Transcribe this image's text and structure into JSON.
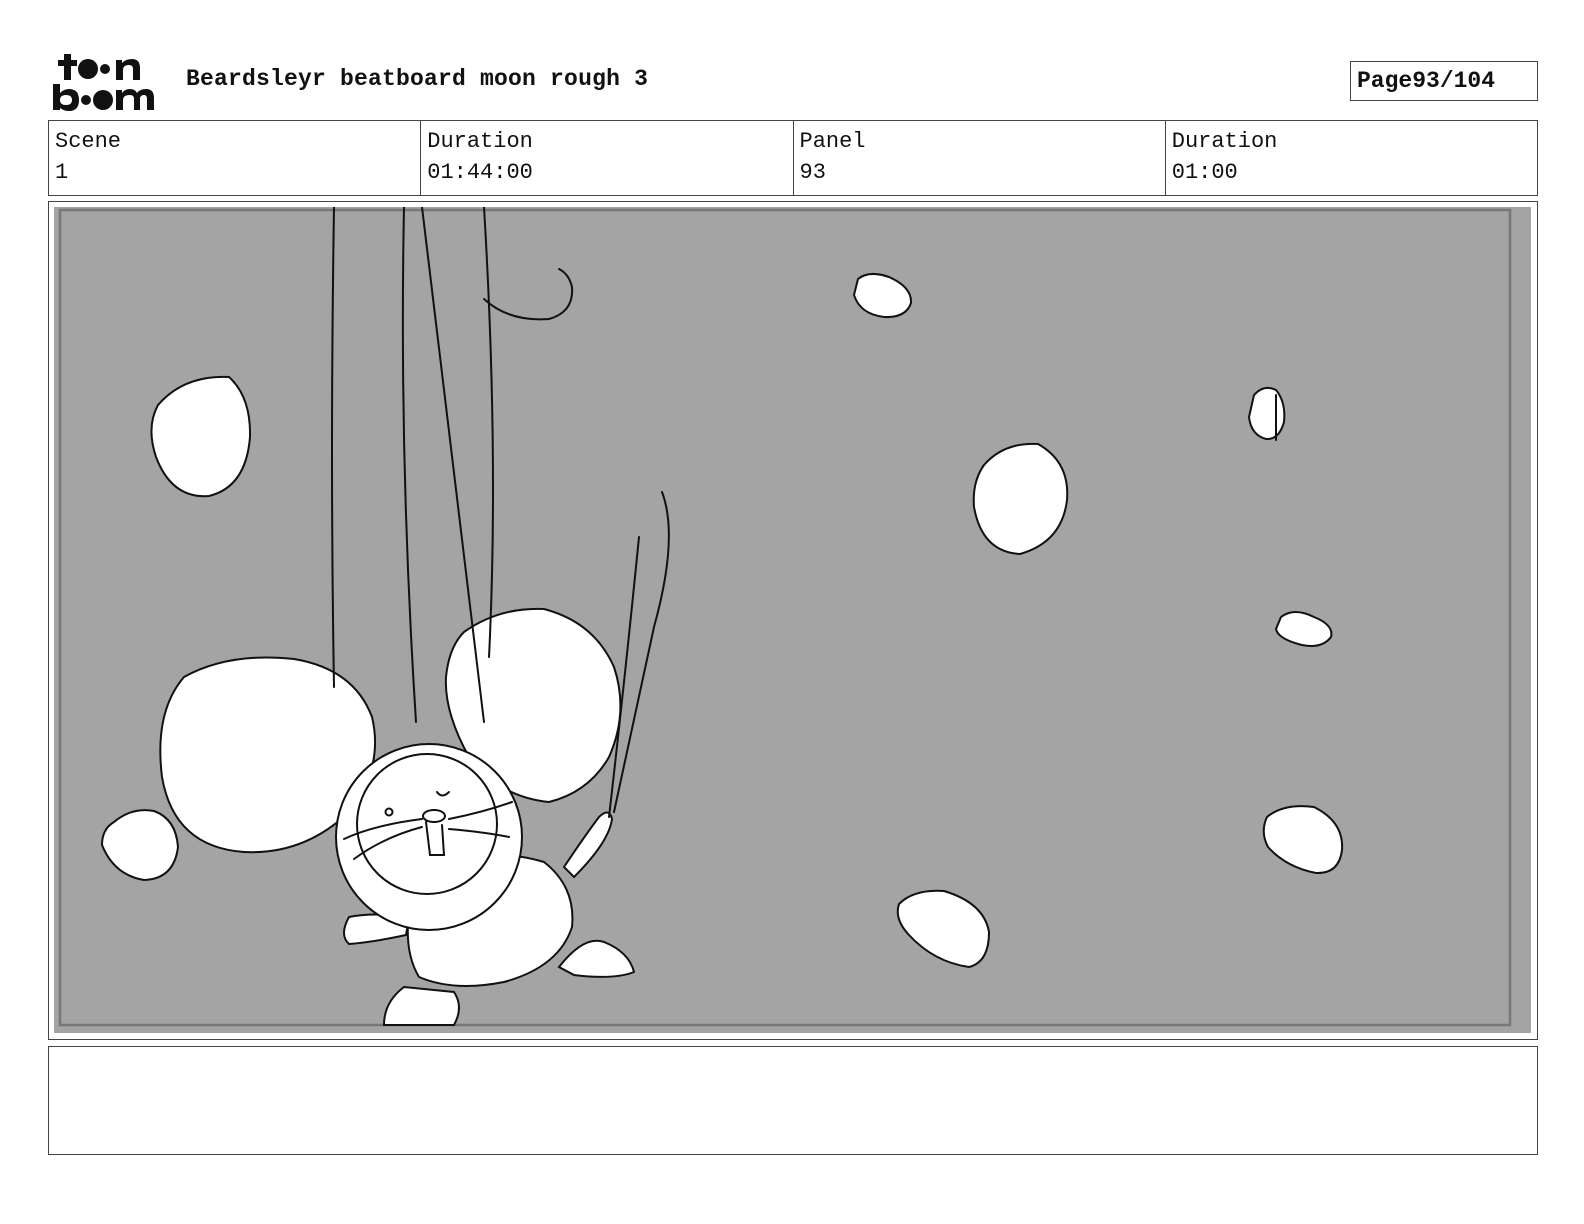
{
  "header": {
    "logo_text": "toon boom",
    "title": "Beardsleyr beatboard moon rough 3",
    "page_label": "Page",
    "page_number": "93/104"
  },
  "info": {
    "scene_label": "Scene",
    "scene_value": "1",
    "scene_duration_label": "Duration",
    "scene_duration_value": "01:44:00",
    "panel_label": "Panel",
    "panel_value": "93",
    "panel_duration_label": "Duration",
    "panel_duration_value": "01:00"
  },
  "panel": {
    "background_color": "#a4a4a4",
    "sketch": "mouse-astronaut-falling-among-moon-rocks"
  },
  "notes": {
    "text": ""
  }
}
